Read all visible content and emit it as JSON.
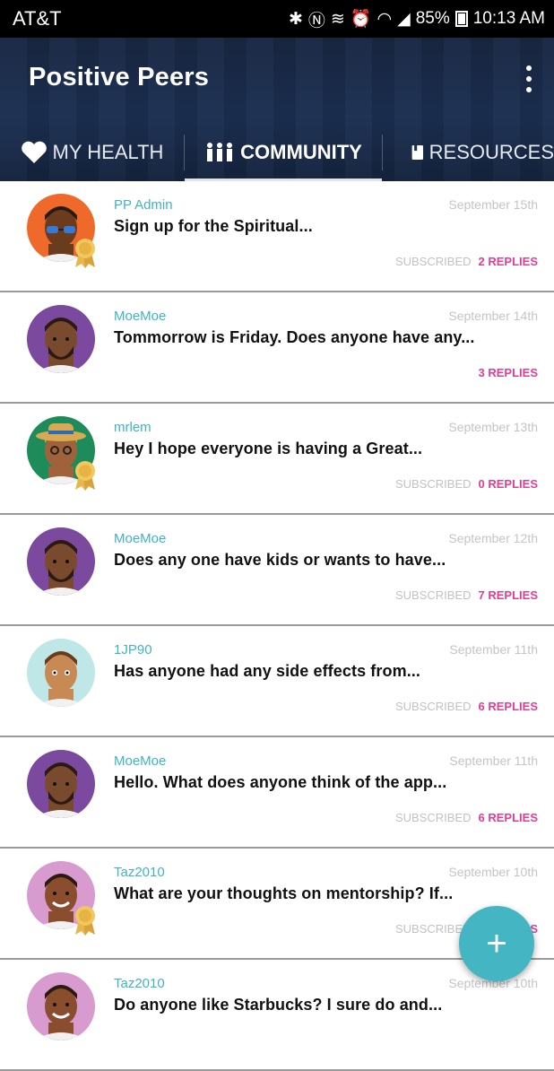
{
  "status_bar": {
    "carrier": "AT&T",
    "battery": "85%",
    "time": "10:13 AM"
  },
  "app": {
    "title": "Positive Peers"
  },
  "tabs": [
    {
      "label": "MY HEALTH",
      "icon": "heart-icon"
    },
    {
      "label": "COMMUNITY",
      "icon": "people-icon",
      "active": true
    },
    {
      "label": "RESOURCES",
      "icon": "book-icon"
    }
  ],
  "posts": [
    {
      "user": "PP Admin",
      "date": "September 15th",
      "title": "Sign up for the Spiritual...",
      "subscribed": "SUBSCRIBED",
      "replies": "2 REPLIES",
      "badge": true
    },
    {
      "user": "MoeMoe",
      "date": "September 14th",
      "title": "Tommorrow is Friday. Does anyone have any...",
      "subscribed": "",
      "replies": "3 REPLIES",
      "badge": false
    },
    {
      "user": "mrlem",
      "date": "September 13th",
      "title": "Hey I hope everyone is having a Great...",
      "subscribed": "SUBSCRIBED",
      "replies": "0 REPLIES",
      "badge": true
    },
    {
      "user": "MoeMoe",
      "date": "September 12th",
      "title": "Does any one have kids or wants to have...",
      "subscribed": "SUBSCRIBED",
      "replies": "7 REPLIES",
      "badge": false
    },
    {
      "user": "1JP90",
      "date": "September 11th",
      "title": "Has anyone had any side effects from...",
      "subscribed": "SUBSCRIBED",
      "replies": "6 REPLIES",
      "badge": false
    },
    {
      "user": "MoeMoe",
      "date": "September 11th",
      "title": "Hello.  What does anyone think of the app...",
      "subscribed": "SUBSCRIBED",
      "replies": "6 REPLIES",
      "badge": false
    },
    {
      "user": "Taz2010",
      "date": "September 10th",
      "title": "What are your thoughts on mentorship? If...",
      "subscribed": "SUBSCRIBED",
      "replies": "3 REPLIES",
      "badge": true
    },
    {
      "user": "Taz2010",
      "date": "September 10th",
      "title": "Do anyone like Starbucks? I sure do and...",
      "subscribed": "",
      "replies": "",
      "badge": false
    }
  ],
  "fab": {
    "label": "+"
  },
  "colors": {
    "header": "#1c2f52",
    "accent": "#3fb4c3",
    "replies": "#de3f93",
    "fab": "#44b5c3"
  }
}
